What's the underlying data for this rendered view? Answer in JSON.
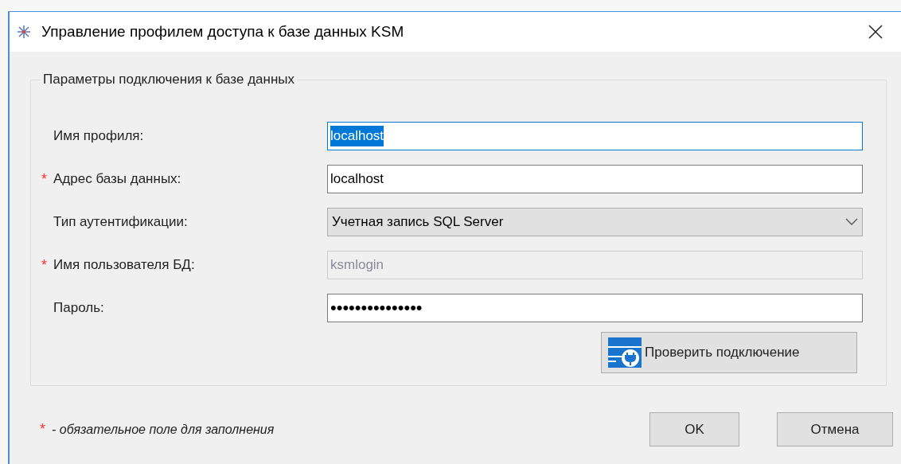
{
  "window": {
    "title": "Управление профилем доступа к базе данных KSM"
  },
  "group": {
    "title": "Параметры подключения к базе данных",
    "fields": [
      {
        "kind": "text",
        "label": "Имя профиля:",
        "value": "localhost",
        "focused": true,
        "text_selected": true,
        "disabled": false
      },
      {
        "kind": "text",
        "required_mark": "*",
        "label": "Адрес базы данных:",
        "value": "localhost",
        "focused": false,
        "text_selected": false,
        "disabled": false
      },
      {
        "kind": "combo",
        "label": "Тип аутентификации:",
        "value": "Учетная запись SQL Server",
        "focused": false,
        "text_selected": false,
        "disabled": false
      },
      {
        "kind": "text",
        "required_mark": "*",
        "label": "Имя пользователя БД:",
        "value": "ksmlogin",
        "focused": false,
        "text_selected": false,
        "disabled": true
      },
      {
        "kind": "password",
        "label": "Пароль:",
        "value": "•••••••••••••••",
        "focused": false,
        "text_selected": false,
        "disabled": false
      }
    ],
    "test_button": "Проверить подключение"
  },
  "footer": {
    "mark": "*",
    "note": "- обязательное поле для заполнения"
  },
  "buttons": [
    "OK",
    "Отмена"
  ]
}
